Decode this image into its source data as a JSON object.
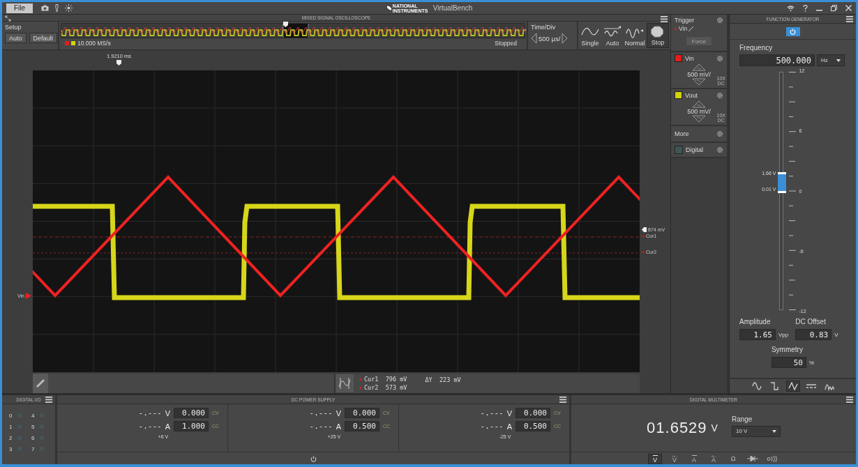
{
  "window": {
    "menu": "File",
    "logo_text": "NATIONAL INSTRUMENTS",
    "title": "VirtualBench"
  },
  "scope": {
    "title": "MIXED SIGNAL OSCILLOSCOPE",
    "setup": {
      "label": "Setup",
      "buttons": [
        "Auto",
        "Default"
      ]
    },
    "overview": {
      "sample_rate": "10.000 MS/s",
      "status": "Stopped"
    },
    "timebase": {
      "label": "Time/Div",
      "value": "500 µs/"
    },
    "acquisition": [
      {
        "kind": "single",
        "label": "Single",
        "selected": false
      },
      {
        "kind": "auto",
        "label": "Auto",
        "selected": false
      },
      {
        "kind": "normal",
        "label": "Normal",
        "selected": false
      },
      {
        "kind": "stop",
        "label": "Stop",
        "selected": true
      }
    ],
    "trigger_time": "1.9210 ms",
    "trigger_level": "874 mV",
    "channel_marker": "Vin",
    "cursors": [
      {
        "label": "Cur1"
      },
      {
        "label": "Cur2"
      }
    ],
    "cursor_readouts": [
      {
        "label": "Cur1",
        "reading": "796 mV"
      },
      {
        "label": "Cur2",
        "reading": "573 mV"
      }
    ],
    "delta": {
      "label": "ΔY",
      "reading": "223 mV"
    }
  },
  "channels": {
    "trigger": {
      "label": "Trigger",
      "source": "Vin",
      "force": "Force",
      "force_disabled": true
    },
    "items": [
      {
        "name": "Vin",
        "color": "#e81c1c",
        "scale": "500 mV/",
        "probe": "10X",
        "coupling": "DC"
      },
      {
        "name": "Vout",
        "color": "#d4d400",
        "scale": "500 mV/",
        "probe": "10X",
        "coupling": "DC"
      }
    ],
    "more": "More",
    "digital": "Digital"
  },
  "function_generator": {
    "title": "FUNCTION GENERATOR",
    "on": true,
    "frequency": {
      "label": "Frequency",
      "value": "500.000",
      "unit": "Hz"
    },
    "scale": [
      "12",
      "6",
      "0",
      "-6",
      "-12"
    ],
    "high": "1.66 V",
    "low": "0.01 V",
    "level": 0.535,
    "amplitude": {
      "label": "Amplitude",
      "value": "1.65",
      "unit": "Vpp"
    },
    "offset": {
      "label": "DC Offset",
      "value": "0.83",
      "unit": "V"
    },
    "symmetry": {
      "label": "Symmetry",
      "value": "50",
      "unit": "%"
    },
    "waveforms": [
      {
        "kind": "sine",
        "selected": false
      },
      {
        "kind": "square",
        "selected": false
      },
      {
        "kind": "triangle",
        "selected": true
      },
      {
        "kind": "dc",
        "selected": false
      },
      {
        "kind": "arbitrary",
        "selected": false
      }
    ]
  },
  "digital_io": {
    "title": "DIGITAL I/O",
    "lines": [
      {
        "label": "0",
        "on": false
      },
      {
        "label": "1",
        "on": false
      },
      {
        "label": "2",
        "on": false
      },
      {
        "label": "3",
        "on": false
      },
      {
        "label": "4",
        "on": false
      },
      {
        "label": "5",
        "on": false
      },
      {
        "label": "6",
        "on": false
      },
      {
        "label": "7",
        "on": false
      }
    ]
  },
  "power_supply": {
    "title": "DC POWER SUPPLY",
    "channels": [
      {
        "label": "+6 V",
        "voltage": {
          "reading": "-.---",
          "unit": "V",
          "value": "0.000",
          "mode": "CV"
        },
        "current": {
          "reading": "-.---",
          "unit": "A",
          "value": "1.000",
          "mode": "CC"
        }
      },
      {
        "label": "+25 V",
        "voltage": {
          "reading": "-.---",
          "unit": "V",
          "value": "0.000",
          "mode": "CV"
        },
        "current": {
          "reading": "-.---",
          "unit": "A",
          "value": "0.500",
          "mode": "CC"
        }
      },
      {
        "label": "-25 V",
        "voltage": {
          "reading": "-.---",
          "unit": "V",
          "value": "0.000",
          "mode": "CV"
        },
        "current": {
          "reading": "-.---",
          "unit": "A",
          "value": "0.500",
          "mode": "CC"
        }
      }
    ]
  },
  "multimeter": {
    "title": "DIGITAL MULTIMETER",
    "reading": "01.6529",
    "unit": "V",
    "range": {
      "label": "Range",
      "value": "10 V"
    },
    "modes": [
      {
        "kind": "dc",
        "symbol": "V",
        "selected": true
      },
      {
        "kind": "ac",
        "symbol": "V",
        "selected": false
      },
      {
        "kind": "dc",
        "symbol": "A",
        "selected": false
      },
      {
        "kind": "ac",
        "symbol": "A",
        "selected": false
      },
      {
        "kind": "resistance",
        "symbol": "Ω",
        "selected": false
      },
      {
        "kind": "diode",
        "selected": false
      },
      {
        "kind": "continuity",
        "selected": false
      }
    ]
  }
}
